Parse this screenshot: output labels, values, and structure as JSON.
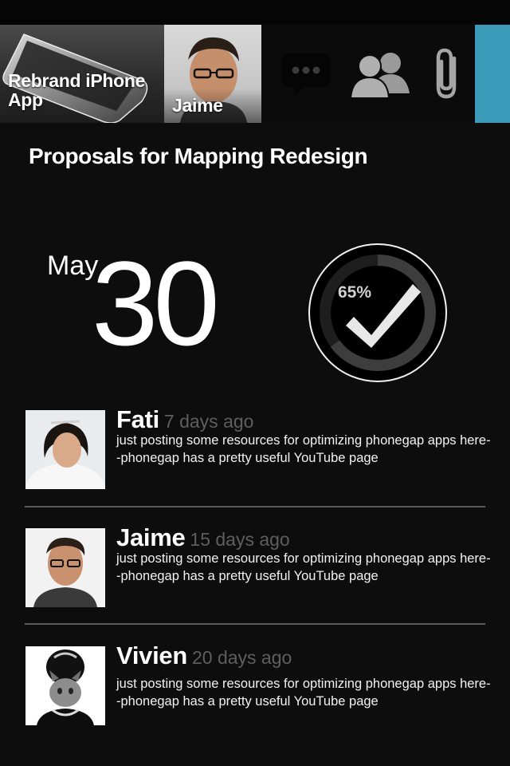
{
  "top_bar": {
    "project_tile": {
      "label": "Rebrand iPhone App"
    },
    "person_tile": {
      "label": "Jaime"
    },
    "icons": [
      "chat-bubble-icon",
      "people-icon",
      "paperclip-icon"
    ],
    "accent_color": "#3c9bb8"
  },
  "page": {
    "title": "Proposals for Mapping Redesign"
  },
  "due_date": {
    "month": "May",
    "day": "30"
  },
  "progress": {
    "label": "65%",
    "value": 0.65
  },
  "posts": [
    {
      "author": "Fati",
      "time": "7 days ago",
      "body": "just posting some resources for optimizing phonegap apps here--phonegap has a pretty useful YouTube page"
    },
    {
      "author": "Jaime",
      "time": "15 days ago",
      "body": "just posting some resources for optimizing phonegap apps here--phonegap has a pretty useful YouTube page"
    },
    {
      "author": "Vivien",
      "time": "20 days ago",
      "body": "just posting some resources for optimizing phonegap apps here--phonegap has a pretty useful YouTube page"
    }
  ]
}
